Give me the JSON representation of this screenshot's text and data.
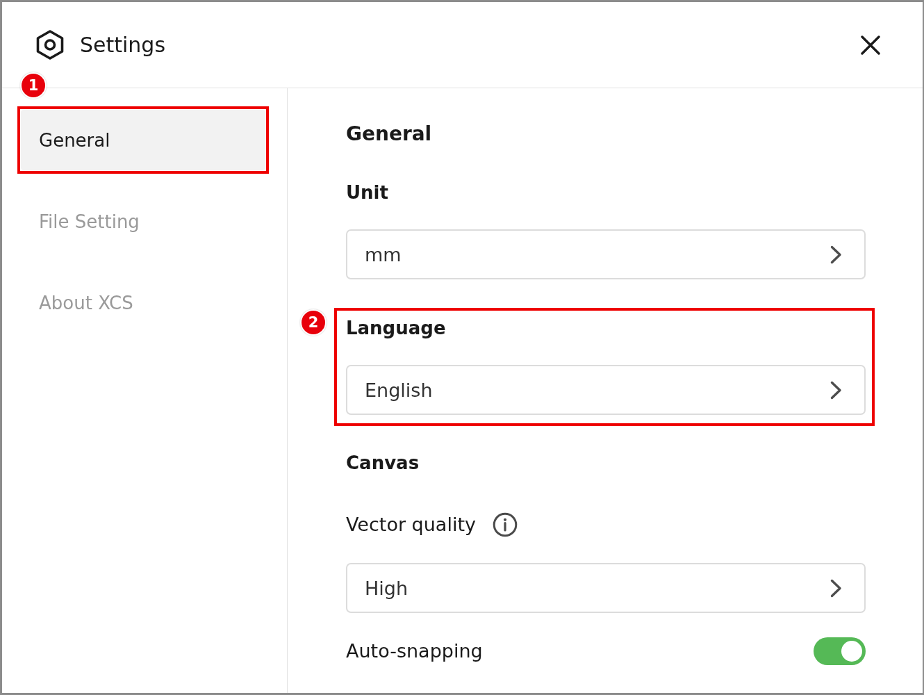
{
  "window": {
    "title": "Settings"
  },
  "sidebar": {
    "items": [
      {
        "label": "General",
        "selected": true,
        "annotation": "1"
      },
      {
        "label": "File Setting",
        "selected": false
      },
      {
        "label": "About XCS",
        "selected": false
      }
    ]
  },
  "panel": {
    "title": "General",
    "sections": [
      {
        "title": "Unit",
        "fields": [
          {
            "kind": "select",
            "value": "mm"
          }
        ]
      },
      {
        "title": "Language",
        "annotation": "2",
        "fields": [
          {
            "kind": "select",
            "value": "English"
          }
        ]
      },
      {
        "title": "Canvas",
        "fields": [
          {
            "kind": "select",
            "label": "Vector quality",
            "info": true,
            "value": "High"
          },
          {
            "kind": "toggle",
            "label": "Auto-snapping",
            "on": true
          }
        ]
      }
    ]
  }
}
